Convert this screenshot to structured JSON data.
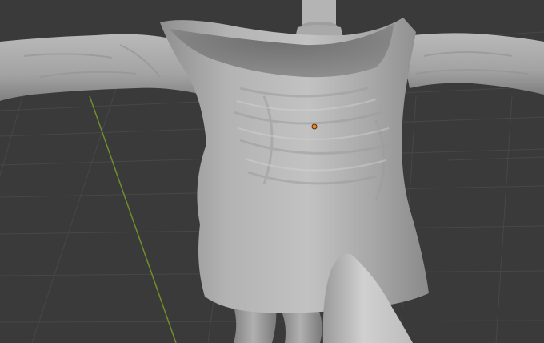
{
  "viewport": {
    "background_color": "#3a3a3a",
    "grid_line_color": "#4a4a4a",
    "y_axis_color": "#6e8f2a",
    "origin_color": "#e8872a",
    "mesh_color": "#a9a9a9"
  },
  "scene": {
    "objects": [
      {
        "name": "shirt",
        "icon": "mesh-object"
      },
      {
        "name": "neck",
        "icon": "mesh-object"
      },
      {
        "name": "legs",
        "icon": "mesh-object"
      }
    ]
  }
}
